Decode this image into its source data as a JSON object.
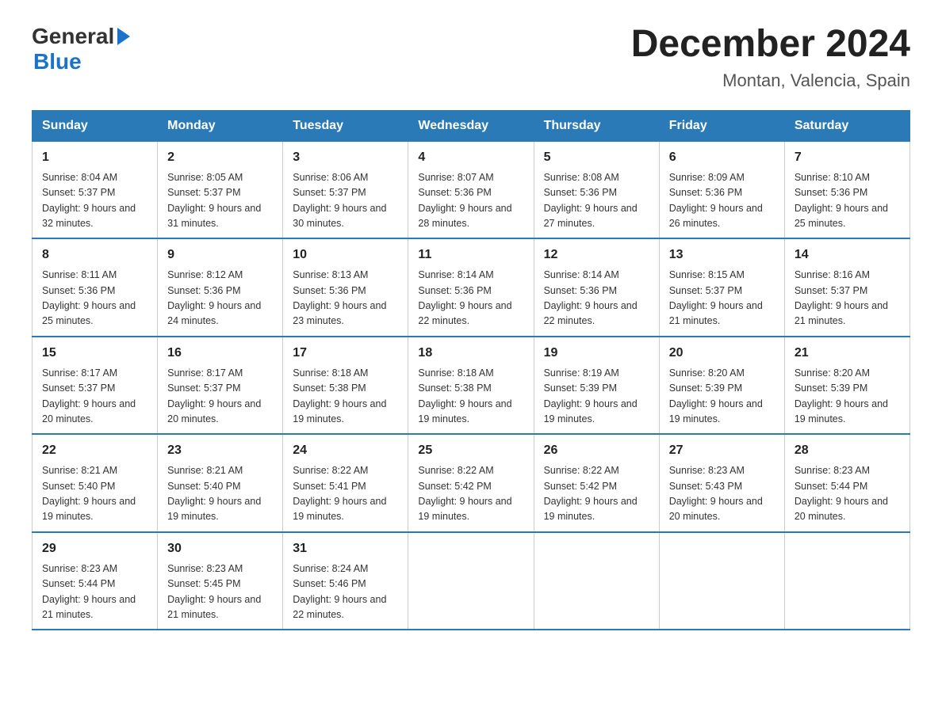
{
  "logo": {
    "line1": "General",
    "triangle": "▶",
    "line2": "Blue"
  },
  "title": "December 2024",
  "subtitle": "Montan, Valencia, Spain",
  "days_of_week": [
    "Sunday",
    "Monday",
    "Tuesday",
    "Wednesday",
    "Thursday",
    "Friday",
    "Saturday"
  ],
  "weeks": [
    [
      {
        "day": "1",
        "sunrise": "8:04 AM",
        "sunset": "5:37 PM",
        "daylight": "9 hours and 32 minutes."
      },
      {
        "day": "2",
        "sunrise": "8:05 AM",
        "sunset": "5:37 PM",
        "daylight": "9 hours and 31 minutes."
      },
      {
        "day": "3",
        "sunrise": "8:06 AM",
        "sunset": "5:37 PM",
        "daylight": "9 hours and 30 minutes."
      },
      {
        "day": "4",
        "sunrise": "8:07 AM",
        "sunset": "5:36 PM",
        "daylight": "9 hours and 28 minutes."
      },
      {
        "day": "5",
        "sunrise": "8:08 AM",
        "sunset": "5:36 PM",
        "daylight": "9 hours and 27 minutes."
      },
      {
        "day": "6",
        "sunrise": "8:09 AM",
        "sunset": "5:36 PM",
        "daylight": "9 hours and 26 minutes."
      },
      {
        "day": "7",
        "sunrise": "8:10 AM",
        "sunset": "5:36 PM",
        "daylight": "9 hours and 25 minutes."
      }
    ],
    [
      {
        "day": "8",
        "sunrise": "8:11 AM",
        "sunset": "5:36 PM",
        "daylight": "9 hours and 25 minutes."
      },
      {
        "day": "9",
        "sunrise": "8:12 AM",
        "sunset": "5:36 PM",
        "daylight": "9 hours and 24 minutes."
      },
      {
        "day": "10",
        "sunrise": "8:13 AM",
        "sunset": "5:36 PM",
        "daylight": "9 hours and 23 minutes."
      },
      {
        "day": "11",
        "sunrise": "8:14 AM",
        "sunset": "5:36 PM",
        "daylight": "9 hours and 22 minutes."
      },
      {
        "day": "12",
        "sunrise": "8:14 AM",
        "sunset": "5:36 PM",
        "daylight": "9 hours and 22 minutes."
      },
      {
        "day": "13",
        "sunrise": "8:15 AM",
        "sunset": "5:37 PM",
        "daylight": "9 hours and 21 minutes."
      },
      {
        "day": "14",
        "sunrise": "8:16 AM",
        "sunset": "5:37 PM",
        "daylight": "9 hours and 21 minutes."
      }
    ],
    [
      {
        "day": "15",
        "sunrise": "8:17 AM",
        "sunset": "5:37 PM",
        "daylight": "9 hours and 20 minutes."
      },
      {
        "day": "16",
        "sunrise": "8:17 AM",
        "sunset": "5:37 PM",
        "daylight": "9 hours and 20 minutes."
      },
      {
        "day": "17",
        "sunrise": "8:18 AM",
        "sunset": "5:38 PM",
        "daylight": "9 hours and 19 minutes."
      },
      {
        "day": "18",
        "sunrise": "8:18 AM",
        "sunset": "5:38 PM",
        "daylight": "9 hours and 19 minutes."
      },
      {
        "day": "19",
        "sunrise": "8:19 AM",
        "sunset": "5:39 PM",
        "daylight": "9 hours and 19 minutes."
      },
      {
        "day": "20",
        "sunrise": "8:20 AM",
        "sunset": "5:39 PM",
        "daylight": "9 hours and 19 minutes."
      },
      {
        "day": "21",
        "sunrise": "8:20 AM",
        "sunset": "5:39 PM",
        "daylight": "9 hours and 19 minutes."
      }
    ],
    [
      {
        "day": "22",
        "sunrise": "8:21 AM",
        "sunset": "5:40 PM",
        "daylight": "9 hours and 19 minutes."
      },
      {
        "day": "23",
        "sunrise": "8:21 AM",
        "sunset": "5:40 PM",
        "daylight": "9 hours and 19 minutes."
      },
      {
        "day": "24",
        "sunrise": "8:22 AM",
        "sunset": "5:41 PM",
        "daylight": "9 hours and 19 minutes."
      },
      {
        "day": "25",
        "sunrise": "8:22 AM",
        "sunset": "5:42 PM",
        "daylight": "9 hours and 19 minutes."
      },
      {
        "day": "26",
        "sunrise": "8:22 AM",
        "sunset": "5:42 PM",
        "daylight": "9 hours and 19 minutes."
      },
      {
        "day": "27",
        "sunrise": "8:23 AM",
        "sunset": "5:43 PM",
        "daylight": "9 hours and 20 minutes."
      },
      {
        "day": "28",
        "sunrise": "8:23 AM",
        "sunset": "5:44 PM",
        "daylight": "9 hours and 20 minutes."
      }
    ],
    [
      {
        "day": "29",
        "sunrise": "8:23 AM",
        "sunset": "5:44 PM",
        "daylight": "9 hours and 21 minutes."
      },
      {
        "day": "30",
        "sunrise": "8:23 AM",
        "sunset": "5:45 PM",
        "daylight": "9 hours and 21 minutes."
      },
      {
        "day": "31",
        "sunrise": "8:24 AM",
        "sunset": "5:46 PM",
        "daylight": "9 hours and 22 minutes."
      },
      null,
      null,
      null,
      null
    ]
  ]
}
